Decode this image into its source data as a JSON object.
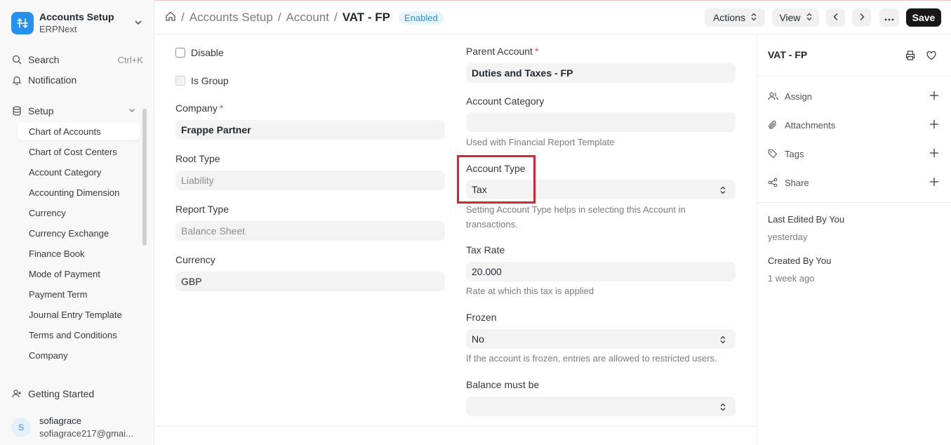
{
  "sidebar": {
    "app_title": "Accounts Setup",
    "app_subtitle": "ERPNext",
    "search_label": "Search",
    "search_shortcut": "Ctrl+K",
    "notification_label": "Notification",
    "setup_label": "Setup",
    "items": [
      {
        "label": "Chart of Accounts"
      },
      {
        "label": "Chart of Cost Centers"
      },
      {
        "label": "Account Category"
      },
      {
        "label": "Accounting Dimension"
      },
      {
        "label": "Currency"
      },
      {
        "label": "Currency Exchange"
      },
      {
        "label": "Finance Book"
      },
      {
        "label": "Mode of Payment"
      },
      {
        "label": "Payment Term"
      },
      {
        "label": "Journal Entry Template"
      },
      {
        "label": "Terms and Conditions"
      },
      {
        "label": "Company"
      }
    ],
    "getting_started": "Getting Started",
    "user": {
      "initial": "S",
      "name": "sofiagrace",
      "email": "sofiagrace217@gmai..."
    }
  },
  "header": {
    "crumb_1": "Accounts Setup",
    "crumb_2": "Account",
    "current": "VAT - FP",
    "status": "Enabled",
    "actions_label": "Actions",
    "view_label": "View",
    "save_label": "Save"
  },
  "form": {
    "disable_label": "Disable",
    "is_group_label": "Is Group",
    "company_label": "Company",
    "company_value": "Frappe Partner",
    "root_type_label": "Root Type",
    "root_type_value": "Liability",
    "report_type_label": "Report Type",
    "report_type_value": "Balance Sheet",
    "currency_label": "Currency",
    "currency_value": "GBP",
    "parent_account_label": "Parent Account",
    "parent_account_value": "Duties and Taxes - FP",
    "account_category_label": "Account Category",
    "account_category_value": "",
    "account_category_help": "Used with Financial Report Template",
    "account_type_label": "Account Type",
    "account_type_value": "Tax",
    "account_type_help_1": "Setting Account Type helps in selecting this Account in",
    "account_type_help_2": "transactions.",
    "tax_rate_label": "Tax Rate",
    "tax_rate_value": "20.000",
    "tax_rate_help": "Rate at which this tax is applied",
    "frozen_label": "Frozen",
    "frozen_value": "No",
    "frozen_help": "If the account is frozen, entries are allowed to restricted users.",
    "balance_label": "Balance must be",
    "balance_value": ""
  },
  "right_pane": {
    "title": "VAT - FP",
    "assign": "Assign",
    "attachments": "Attachments",
    "tags": "Tags",
    "share": "Share",
    "last_edited": "Last Edited By You",
    "last_edited_time": "yesterday",
    "created": "Created By You",
    "created_time": "1 week ago"
  },
  "colors": {
    "accent": "#2490ef",
    "highlight": "#e0222d",
    "save_bg": "#171717"
  }
}
